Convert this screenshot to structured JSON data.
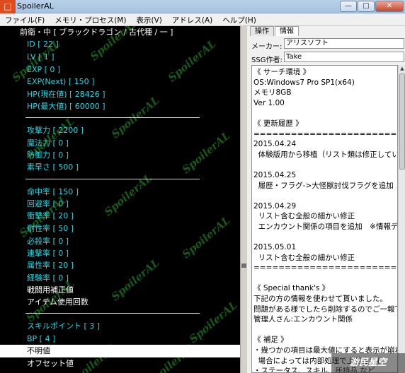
{
  "window": {
    "title": "SpoilerAL",
    "minimize": "—",
    "maximize": "□",
    "close": "✕"
  },
  "menu": [
    "ファイル(F)",
    "メモリ・プロセス(M)",
    "表示(V)",
    "アドレス(A)",
    "ヘルプ(H)"
  ],
  "tree": {
    "header": "前衛・中 [ ブラックドラゴン / 古代種 / 一 ]",
    "stats1": [
      "ID [ 22 ]",
      "LV [ 1 ]",
      "EXP [ 0 ]",
      "EXP(Next) [ 150 ]",
      "HP(現在値) [ 28426 ]",
      "HP(最大値) [ 60000 ]"
    ],
    "stats2": [
      "攻撃力 [ 2200 ]",
      "魔法力 [ 0 ]",
      "防御力 [ 0 ]",
      "素早さ [ 500 ]"
    ],
    "stats3": [
      "命中率 [ 150 ]",
      "回避率 [ 0 ]",
      "衝撃率 [ 20 ]",
      "耐性率 [ 50 ]",
      "必殺率 [ 0 ]",
      "連撃率 [ 0 ]",
      "属性率 [ 20 ]",
      "経験率 [ 0 ]"
    ],
    "white1": [
      "戦闘用補正値",
      "アイテム使用回数"
    ],
    "stats4": [
      "スキルポイント [ 3 ]",
      "BP [ 4 ]"
    ],
    "selected": "不明値",
    "white2": [
      "オフセット値"
    ],
    "watermark": "SpoilerAL"
  },
  "right_panel": {
    "tabs": [
      "操作",
      "情報"
    ],
    "maker_label": "メーカー:",
    "maker_value": "アリスソフト",
    "author_label": "SSG作者:",
    "author_value": "Take",
    "info_lines": [
      "《 サーチ環境 》",
      "OS:Windows7 Pro SP1(x64)",
      "メモリ8GB",
      "Ver 1.00",
      "",
      "《 更新履歴 》",
      "================================",
      "2015.04.24",
      "  体験版用から移植（リスト類は修正してい",
      "",
      "2015.04.25",
      "  履歴・フラグ->大怪獣討伐フラグを追加",
      "",
      "2015.04.29",
      "  リスト含む全般の細かい修正",
      "  エンカウント関係の項目を追加　※情報デ",
      "",
      "2015.05.01",
      "  リスト含む全般の細かい修正",
      "================================",
      "",
      "《 Special thank's 》",
      "下記の方の情報を使わせて貰いました。",
      "問題がある様でしたら削除するのでご一報下",
      "管理人さん:エンカウント関係",
      "",
      "《 補足 》",
      "・幾つかの項目は最大値にすると表示が崩れ",
      "  場合によっては内部処理で上書きされ",
      "・ステータス、スキル、所持品 など"
    ]
  },
  "stamp": "游民星空"
}
